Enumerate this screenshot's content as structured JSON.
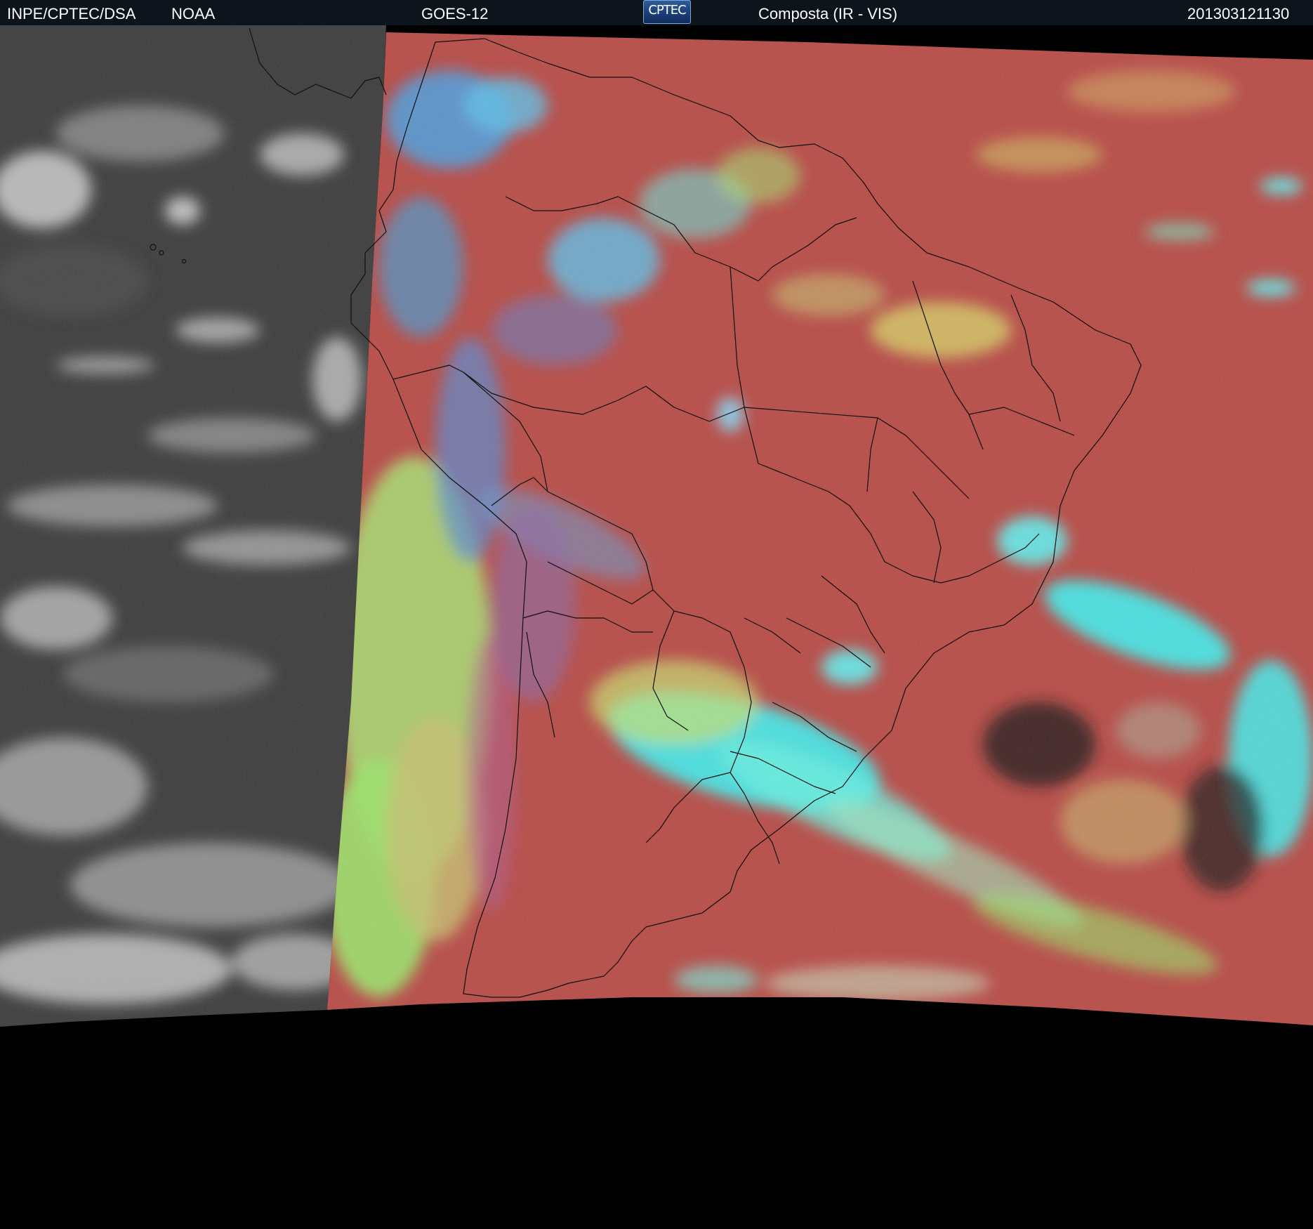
{
  "header": {
    "institution": "INPE/CPTEC/DSA",
    "agency": "NOAA",
    "satellite": "GOES-12",
    "logo_text": "CPTEC",
    "product": "Composta (IR - VIS)",
    "timestamp": "201303121130"
  },
  "colors": {
    "background": "#000000",
    "header_bar": "#0d141c",
    "header_text": "#ffffff",
    "ir_gray": "#3a3a3a",
    "land_red": "#b84a45",
    "cloud_cyan": "#3ff0f0",
    "cloud_blue": "#4aa0e0",
    "cloud_green": "#9be36a",
    "cloud_yellow": "#d8d86a",
    "border_lines": "#101010"
  }
}
